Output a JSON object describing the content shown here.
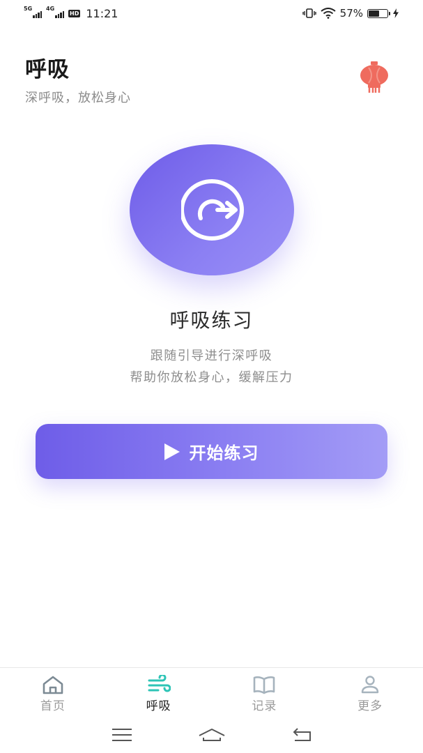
{
  "status_bar": {
    "sim1_label": "5G",
    "sim2_label": "4G",
    "hd_label": "HD",
    "time": "11:21",
    "battery_text": "57%",
    "battery_level": 0.57
  },
  "header": {
    "title": "呼吸",
    "subtitle": "深呼吸，放松身心",
    "decor_icon": "lantern-icon"
  },
  "practice": {
    "icon": "breath-refresh-icon",
    "title": "呼吸练习",
    "desc_line1": "跟随引导进行深呼吸",
    "desc_line2": "帮助你放松身心，缓解压力",
    "start_label": "开始练习"
  },
  "bottom_nav": {
    "items": [
      {
        "label": "首页",
        "icon": "home-icon",
        "active": false
      },
      {
        "label": "呼吸",
        "icon": "wind-icon",
        "active": true
      },
      {
        "label": "记录",
        "icon": "book-icon",
        "active": false
      },
      {
        "label": "更多",
        "icon": "person-icon",
        "active": false
      }
    ]
  },
  "colors": {
    "accent": "#7b6cee",
    "accent_light": "#a39cf6",
    "active_tab": "#2ec4b6",
    "lantern": "#ef6b5e"
  }
}
